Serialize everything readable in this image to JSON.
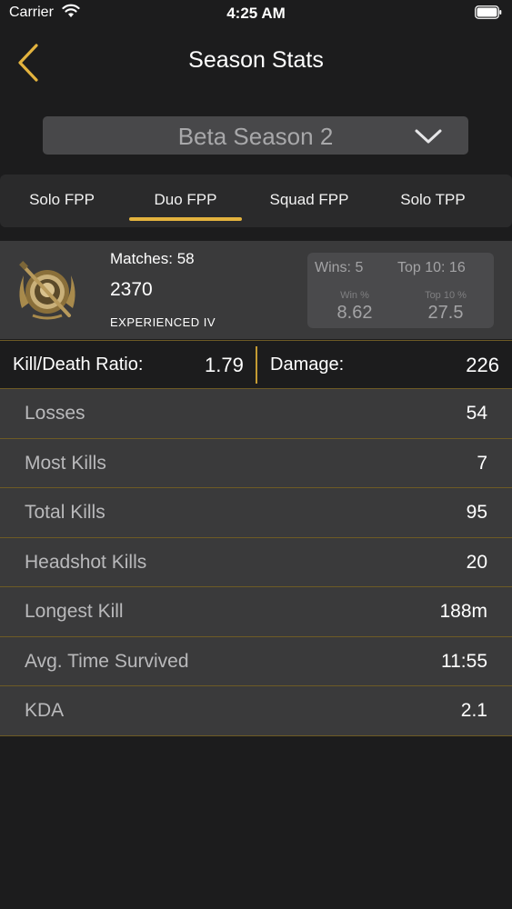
{
  "status_bar": {
    "carrier": "Carrier",
    "time": "4:25 AM"
  },
  "nav": {
    "title": "Season Stats"
  },
  "season_selector": {
    "selected": "Beta Season 2"
  },
  "tabs": [
    {
      "label": "Solo FPP",
      "active": false
    },
    {
      "label": "Duo FPP",
      "active": true
    },
    {
      "label": "Squad FPP",
      "active": false
    },
    {
      "label": "Solo TPP",
      "active": false
    }
  ],
  "summary": {
    "matches": "Matches: 58",
    "rating": "2370",
    "tier": "EXPERIENCED IV",
    "wins": "Wins: 5",
    "top10": "Top 10: 16",
    "win_pct_label": "Win %",
    "win_pct": "8.62",
    "top10_pct_label": "Top 10 %",
    "top10_pct": "27.5"
  },
  "kd_row": {
    "kd_label": "Kill/Death Ratio:",
    "kd_value": "1.79",
    "damage_label": "Damage:",
    "damage_value": "226"
  },
  "stats": [
    {
      "label": "Losses",
      "value": "54"
    },
    {
      "label": "Most Kills",
      "value": "7"
    },
    {
      "label": "Total Kills",
      "value": "95"
    },
    {
      "label": "Headshot Kills",
      "value": "20"
    },
    {
      "label": "Longest Kill",
      "value": "188m"
    },
    {
      "label": "Avg. Time Survived",
      "value": "11:55"
    },
    {
      "label": "KDA",
      "value": "2.1"
    }
  ],
  "colors": {
    "accent": "#e3b33e",
    "background": "#1c1c1d",
    "row": "#3a3a3b",
    "divider": "#6e5b25"
  }
}
